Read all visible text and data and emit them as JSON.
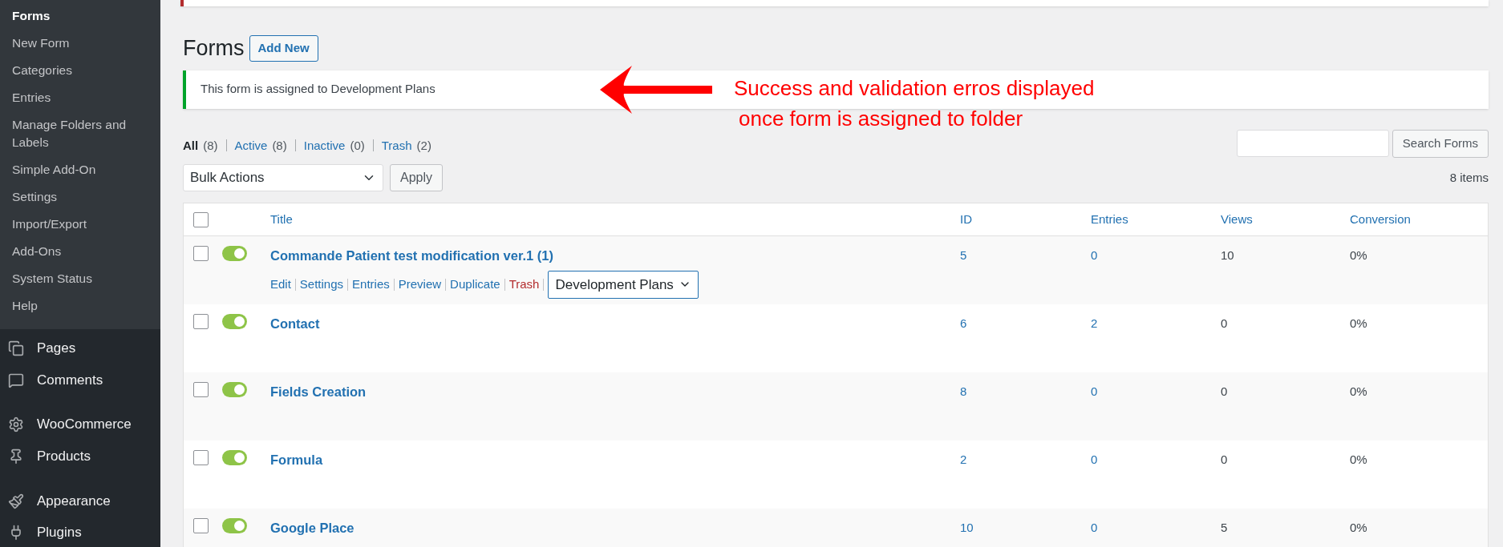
{
  "sidebar": {
    "submenu": [
      {
        "label": "Forms",
        "selected": true
      },
      {
        "label": "New Form",
        "selected": false
      },
      {
        "label": "Categories",
        "selected": false
      },
      {
        "label": "Entries",
        "selected": false
      },
      {
        "label": "Manage Folders and Labels",
        "selected": false
      },
      {
        "label": "Simple Add-On",
        "selected": false
      },
      {
        "label": "Settings",
        "selected": false
      },
      {
        "label": "Import/Export",
        "selected": false
      },
      {
        "label": "Add-Ons",
        "selected": false
      },
      {
        "label": "System Status",
        "selected": false
      },
      {
        "label": "Help",
        "selected": false
      }
    ],
    "menu": [
      {
        "label": "Pages"
      },
      {
        "label": "Comments"
      },
      {
        "label": "WooCommerce"
      },
      {
        "label": "Products"
      },
      {
        "label": "Appearance"
      },
      {
        "label": "Plugins"
      }
    ]
  },
  "page": {
    "title": "Forms",
    "add_new": "Add New"
  },
  "notice": {
    "text": "This form is assigned to Development Plans"
  },
  "annotation": {
    "lines": [
      "Success and validation erros displayed",
      "once form is assigned to folder"
    ]
  },
  "filters": [
    {
      "label": "All",
      "count": "(8)",
      "selected": true
    },
    {
      "label": "Active",
      "count": "(8)",
      "selected": false
    },
    {
      "label": "Inactive",
      "count": "(0)",
      "selected": false
    },
    {
      "label": "Trash",
      "count": "(2)",
      "selected": false
    }
  ],
  "bulk_actions": {
    "value": "Bulk Actions",
    "apply": "Apply"
  },
  "search": {
    "button": "Search Forms"
  },
  "item_count": "8 items",
  "table": {
    "columns": [
      "Title",
      "ID",
      "Entries",
      "Views",
      "Conversion"
    ],
    "select_all": {
      "checked": false
    },
    "rows": [
      {
        "checked": false,
        "on": true,
        "title": "Commande Patient test modification ver.1 (1)",
        "id": "5",
        "entries": "0",
        "views": "10",
        "conversion": "0%",
        "actions": [
          {
            "label": "Edit",
            "kind": "link"
          },
          {
            "label": "Settings",
            "kind": "link"
          },
          {
            "label": "Entries",
            "kind": "link"
          },
          {
            "label": "Preview",
            "kind": "link"
          },
          {
            "label": "Duplicate",
            "kind": "link"
          },
          {
            "label": "Trash",
            "kind": "danger"
          }
        ],
        "folder": "Development Plans"
      },
      {
        "checked": false,
        "on": true,
        "title": "Contact",
        "id": "6",
        "entries": "2",
        "views": "0",
        "conversion": "0%"
      },
      {
        "checked": false,
        "on": true,
        "title": "Fields Creation",
        "id": "8",
        "entries": "0",
        "views": "0",
        "conversion": "0%"
      },
      {
        "checked": false,
        "on": true,
        "title": "Formula",
        "id": "2",
        "entries": "0",
        "views": "0",
        "conversion": "0%"
      },
      {
        "checked": false,
        "on": true,
        "title": "Google Place",
        "id": "10",
        "entries": "0",
        "views": "5",
        "conversion": "0%"
      }
    ]
  }
}
